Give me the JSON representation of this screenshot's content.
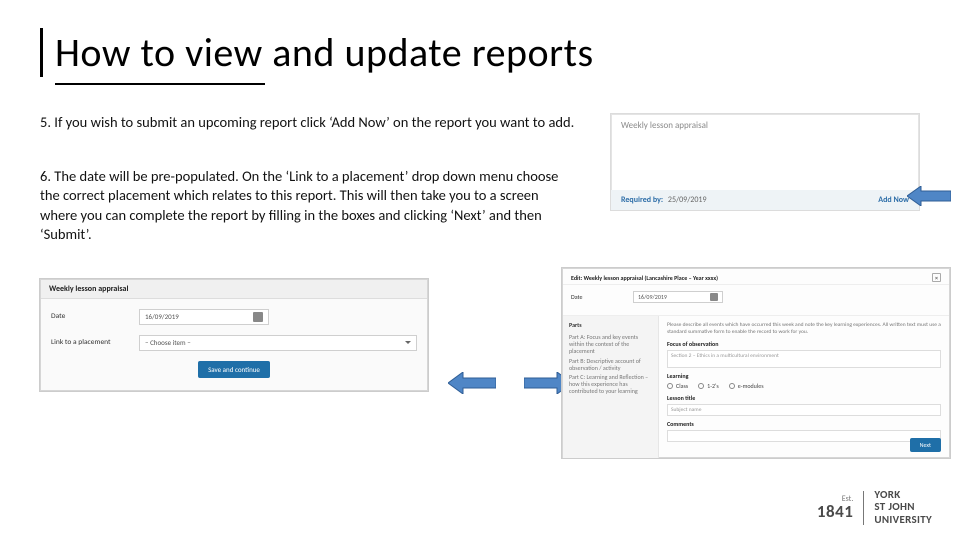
{
  "title": "How to view and update reports",
  "steps": {
    "s5": "5. If you wish to submit an upcoming report click ‘Add Now’ on the report you want to add.",
    "s6": "6. The date will be pre-populated. On the ‘Link to a placement’ drop down menu choose the correct placement which relates to this report. This will then take you to a screen where you can complete the report by filling in the boxes and clicking ‘Next’ and then ‘Submit’."
  },
  "panelTop": {
    "title": "Weekly lesson appraisal",
    "requiredLabel": "Required by:",
    "requiredDate": "25/09/2019",
    "addNow": "Add Now"
  },
  "panelForm": {
    "title": "Weekly lesson appraisal",
    "dateLabel": "Date",
    "dateValue": "16/09/2019",
    "linkLabel": "Link to a placement",
    "linkPlaceholder": "– Choose item –",
    "saveBtn": "Save and continue"
  },
  "panelBig": {
    "head": "Edit: Weekly lesson appraisal (Lancashire Place – Year xxxx)",
    "dateLabel": "Date",
    "dateValue": "16/09/2019",
    "sideHead": "Parts",
    "sideItems": [
      "Part A: Focus and key events within the context of the placement",
      "Part B: Descriptive account of observation / activity",
      "Part C: Learning and Reflection – how this experience has contributed to your learning"
    ],
    "desc": "Please describe all events which have occurred this week and note the key learning experiences. All written text must use a standard summative form to enable the record to work for you.",
    "focusTitle": "Focus of observation",
    "focusValue": "Section 2 – Ethics in a multicultural environment",
    "learningTitle": "Learning",
    "radios": [
      "Class",
      "1-2's",
      "e-modules"
    ],
    "lessonTitle": "Lesson title",
    "lessonValue": "Subject name",
    "commentsTitle": "Comments",
    "nextBtn": "Next"
  },
  "logo": {
    "est": "Est.",
    "year": "1841",
    "line1": "YORK",
    "line2": "ST JOHN",
    "line3": "UNIVERSITY"
  }
}
